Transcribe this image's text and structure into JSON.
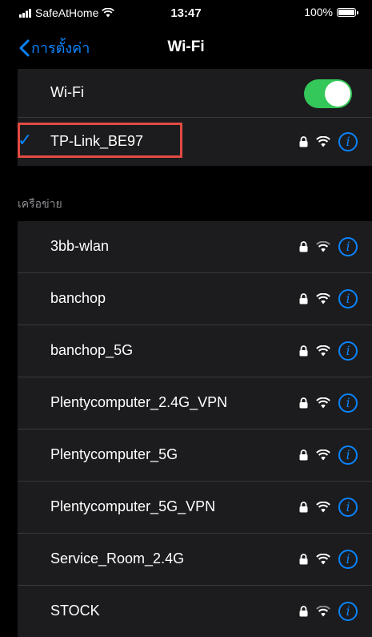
{
  "status": {
    "carrier": "SafeAtHome",
    "time": "13:47",
    "battery": "100%"
  },
  "nav": {
    "back_label": "การตั้งค่า",
    "title": "Wi-Fi"
  },
  "wifi_toggle": {
    "label": "Wi-Fi",
    "on": true
  },
  "connected": {
    "name": "TP-Link_BE97"
  },
  "networks_header": "เครือข่าย",
  "networks": [
    {
      "name": "3bb-wlan"
    },
    {
      "name": "banchop"
    },
    {
      "name": "banchop_5G"
    },
    {
      "name": "Plentycomputer_2.4G_VPN"
    },
    {
      "name": "Plentycomputer_5G"
    },
    {
      "name": "Plentycomputer_5G_VPN"
    },
    {
      "name": "Service_Room_2.4G"
    },
    {
      "name": "STOCK"
    }
  ],
  "colors": {
    "accent": "#0a84ff",
    "toggle_on": "#34c759",
    "highlight": "#e24b43"
  }
}
